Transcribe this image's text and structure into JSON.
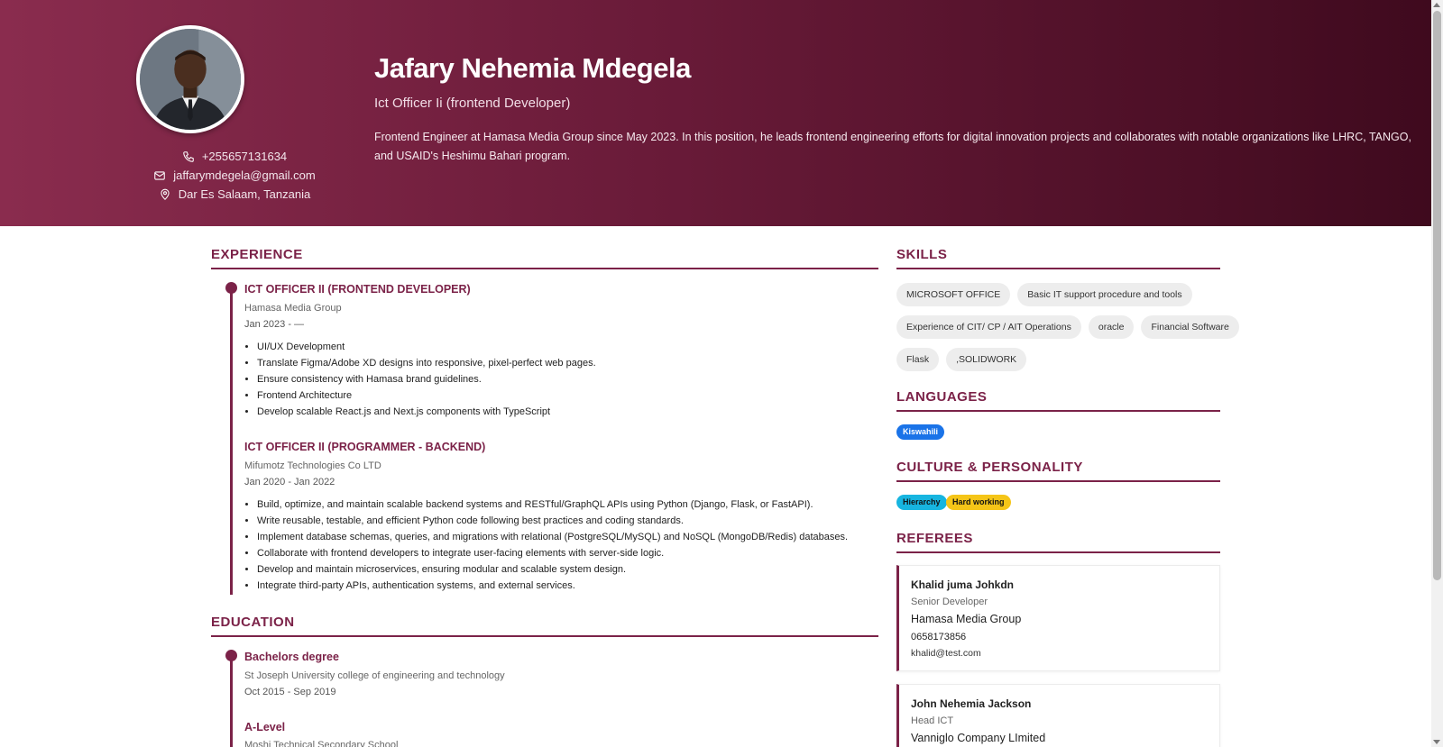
{
  "profile": {
    "name": "Jafary Nehemia Mdegela",
    "role": "Ict Officer Ii (frontend Developer)",
    "summary": "Frontend Engineer at Hamasa Media Group since May 2023. In this position, he leads frontend engineering efforts for digital innovation projects and collaborates with notable organizations like LHRC, TANGO, and USAID's Heshimu Bahari program.",
    "phone": "+255657131634",
    "email": "jaffarymdegela@gmail.com",
    "location": "Dar Es Salaam, Tanzania"
  },
  "experience": {
    "title": "EXPERIENCE",
    "jobs": [
      {
        "title": "ICT OFFICER II (FRONTEND DEVELOPER)",
        "company": "Hamasa Media Group",
        "dates": "Jan 2023 - —",
        "bullets": [
          "UI/UX Development",
          "Translate Figma/Adobe XD designs into responsive, pixel-perfect web pages.",
          "Ensure consistency with Hamasa brand guidelines.",
          "Frontend Architecture",
          "Develop scalable React.js and Next.js components with TypeScript"
        ]
      },
      {
        "title": "ICT OFFICER II (PROGRAMMER - BACKEND)",
        "company": "Mifumotz Technologies Co LTD",
        "dates": "Jan 2020 - Jan 2022",
        "bullets": [
          "Build, optimize, and maintain scalable backend systems and RESTful/GraphQL APIs using Python (Django, Flask, or FastAPI).",
          "Write reusable, testable, and efficient Python code following best practices and coding standards.",
          "Implement database schemas, queries, and migrations with relational (PostgreSQL/MySQL) and NoSQL (MongoDB/Redis) databases.",
          "Collaborate with frontend developers to integrate user-facing elements with server-side logic.",
          "Develop and maintain microservices, ensuring modular and scalable system design.",
          "Integrate third-party APIs, authentication systems, and external services."
        ]
      }
    ]
  },
  "education": {
    "title": "EDUCATION",
    "items": [
      {
        "degree": "Bachelors degree",
        "school": "St Joseph University college of engineering and technology",
        "dates": "Oct 2015 - Sep 2019"
      },
      {
        "degree": "A-Level",
        "school": "Moshi Technical Secondary School"
      }
    ]
  },
  "skills": {
    "title": "SKILLS",
    "rows": [
      [
        "MICROSOFT OFFICE",
        "Basic IT support procedure and tools"
      ],
      [
        "Experience of CIT/ CP / AIT Operations",
        "oracle",
        "Financial Software"
      ],
      [
        "Flask",
        ",SOLIDWORK"
      ]
    ]
  },
  "languages": {
    "title": "LANGUAGES",
    "items": [
      "Kiswahili"
    ],
    "color": "#1a73e8"
  },
  "culture": {
    "title": "CULTURE & PERSONALITY",
    "items": [
      "Hierarchy",
      "Hard working"
    ],
    "colors": [
      "#17b5e0",
      "#f5c518"
    ]
  },
  "referees": {
    "title": "REFEREES",
    "items": [
      {
        "name": "Khalid juma Johkdn",
        "position": "Senior Developer",
        "org": "Hamasa Media Group",
        "phone": "0658173856",
        "email": "khalid@test.com"
      },
      {
        "name": "John Nehemia Jackson",
        "position": "Head ICT",
        "org": "Vanniglo Company LImited"
      }
    ]
  },
  "theme": {
    "accent": "#7b2248"
  }
}
